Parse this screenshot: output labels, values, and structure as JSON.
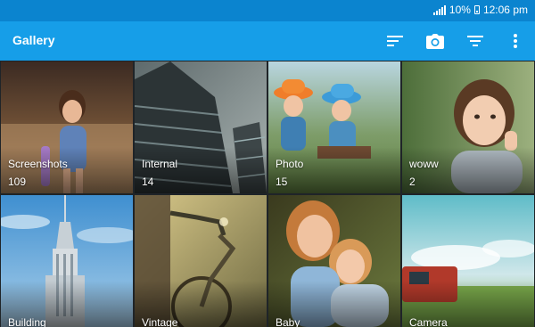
{
  "status_bar": {
    "battery": "10%",
    "time": "12:06 pm"
  },
  "app_bar": {
    "title": "Gallery"
  },
  "albums": [
    {
      "name": "Screenshots",
      "count": "109"
    },
    {
      "name": "Internal",
      "count": "14"
    },
    {
      "name": "Photo",
      "count": "15"
    },
    {
      "name": "woww",
      "count": "2"
    },
    {
      "name": "Building"
    },
    {
      "name": "Vintage"
    },
    {
      "name": "Baby"
    },
    {
      "name": "Camera"
    }
  ],
  "colors": {
    "status_bar": "#0b84cf",
    "app_bar": "#169ee8"
  }
}
